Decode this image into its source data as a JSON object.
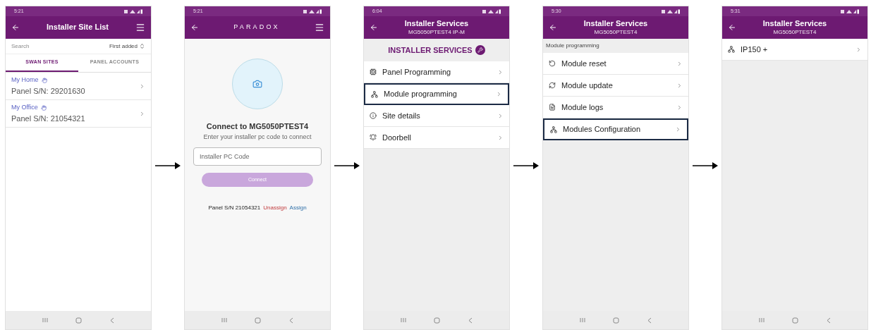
{
  "screens": [
    {
      "kind": "site_list",
      "time": "5:21",
      "title": "Installer Site List",
      "search": {
        "placeholder": "Search"
      },
      "sort": "First added",
      "tabs": [
        {
          "label": "SWAN SITES",
          "selected": true
        },
        {
          "label": "PANEL ACCOUNTS",
          "selected": false
        }
      ],
      "sites": [
        {
          "name": "My Home",
          "serial": "Panel S/N: 29201630"
        },
        {
          "name": "My Office",
          "serial": "Panel S/N: 21054321"
        }
      ]
    },
    {
      "kind": "connect",
      "time": "5:21",
      "brand": "PARADOX",
      "heading": "Connect to MG5050PTEST4",
      "subtitle": "Enter your installer pc code to connect",
      "code_field": {
        "placeholder": "Installer PC Code"
      },
      "connect_button": {
        "label": "Connect",
        "disabled": true
      },
      "serial": "Panel S/N 21054321",
      "unassign": "Unassign",
      "assign": "Assign"
    },
    {
      "kind": "services",
      "time": "6:04",
      "title": "Installer Services",
      "subtitle": "MG5050PTEST4 IP-M",
      "section": {
        "label": "INSTALLER SERVICES"
      },
      "items": [
        {
          "label": "Panel Programming",
          "selected": false
        },
        {
          "label": "Module programming",
          "selected": true
        },
        {
          "label": "Site details",
          "selected": false
        },
        {
          "label": "Doorbell",
          "selected": false
        }
      ]
    },
    {
      "kind": "module_programming",
      "time": "5:30",
      "title": "Installer Services",
      "subtitle": "MG5050PTEST4",
      "section": {
        "label": "Module programming"
      },
      "items": [
        {
          "label": "Module reset",
          "selected": false
        },
        {
          "label": "Module update",
          "selected": false
        },
        {
          "label": "Module logs",
          "selected": false
        },
        {
          "label": "Modules Configuration",
          "selected": true
        }
      ]
    },
    {
      "kind": "modules",
      "time": "5:31",
      "title": "Installer Services",
      "subtitle": "MG5050PTEST4",
      "items": [
        {
          "label": "IP150 +",
          "selected": false
        }
      ]
    }
  ]
}
